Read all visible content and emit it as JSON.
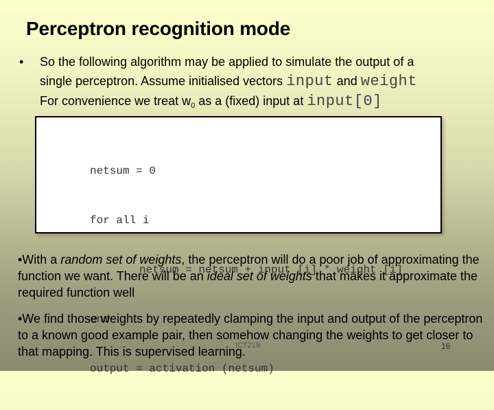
{
  "slide": {
    "title": "Perceptron recognition mode",
    "intro_bullet": {
      "bullet": "•",
      "line1": "So the following algorithm may be applied to simulate the output of a",
      "line2_text": "single perceptron.  Assume initialised vectors ",
      "line2_code1": "input",
      "line2_and": " and ",
      "line2_code2": "weight",
      "line3_text": "For convenience we treat w",
      "line3_sub": "0",
      "line3_text2": " as a (fixed) input at ",
      "line3_code": "input[0]"
    },
    "code_lines": [
      "netsum = 0",
      "for all i",
      "netsum = netsum + input [i] * weight [i]",
      "end",
      "output = activation (netsum)"
    ],
    "paragraph1": {
      "prefix": "•With a ",
      "italic1": "random set of weights",
      "mid": ", the perceptron will do a poor job of approximating the function we want. There will be an ",
      "italic2": "ideal set of weights",
      "suffix": " that makes it approximate the required function well"
    },
    "paragraph2": "•We find those weights by repeatedly clamping the input and output of the perceptron to a known good example pair, then somehow changing the weights to get closer to that mapping. This is supervised learning.",
    "footer_label": "ICT219",
    "page_number": "16"
  }
}
